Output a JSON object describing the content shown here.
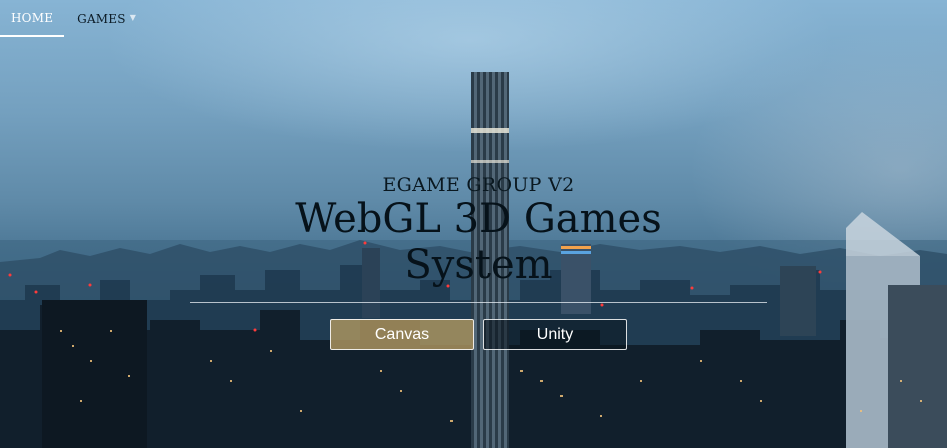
{
  "nav": {
    "items": [
      {
        "label": "HOME",
        "active": true
      },
      {
        "label": "GAMES",
        "has_dropdown": true
      }
    ]
  },
  "hero": {
    "kicker": "EGAME GROUP V2",
    "title_line1": "WebGL 3D Games",
    "title_line2": "System"
  },
  "buttons": {
    "canvas": "Canvas",
    "unity": "Unity"
  },
  "colors": {
    "canvas_button_bg": "#af965f",
    "unity_button_bg": "#0a141e",
    "text_dark": "#06121a",
    "nav_text": "#ffffff"
  },
  "icons": {
    "games_dropdown": "chevron-down-icon"
  }
}
